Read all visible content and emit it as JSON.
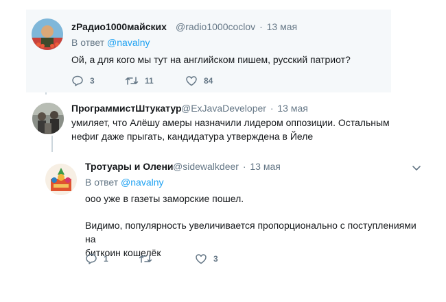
{
  "tweets": [
    {
      "name": "zРадио1000майских",
      "handle": "@radio1000coclov",
      "dot": "·",
      "date": "13 мая",
      "reply_prefix": "В ответ",
      "reply_handle": "@navalny",
      "text": "Ой, а для кого мы тут на английском пишем, русский патриот?",
      "replies": "3",
      "retweets": "11",
      "likes": "84"
    },
    {
      "name": "ПрограммистШтукатур",
      "handle": "@ExJavaDeveloper",
      "dot": "·",
      "date": "13 мая",
      "text_lines": [
        "умиляет, что Алёшу амеры назначили лидером оппозиции. Остальным",
        "нефиг даже прыгать, кандидатура утверждена в Йеле"
      ]
    },
    {
      "name": "Тротуары и Олени",
      "handle": "@sidewalkdeer",
      "dot": "·",
      "date": "13 мая",
      "reply_prefix": "В ответ",
      "reply_handle": "@navalny",
      "text_p1": "ооо уже в газеты заморские пошел.",
      "text_p2_lines": [
        "Видимо, популярность увеличивается пропорционально с поступлениями на",
        "биткоин кошелёк"
      ],
      "replies": "1",
      "retweets": "",
      "likes": "3"
    }
  ],
  "colors": {
    "link": "#1da1f2",
    "secondary": "#657786",
    "highlight_bg": "#f5f8fa",
    "thread_line": "#ccd6dd"
  },
  "icons": [
    "reply-icon",
    "retweet-icon",
    "like-icon",
    "caret-down-icon"
  ]
}
